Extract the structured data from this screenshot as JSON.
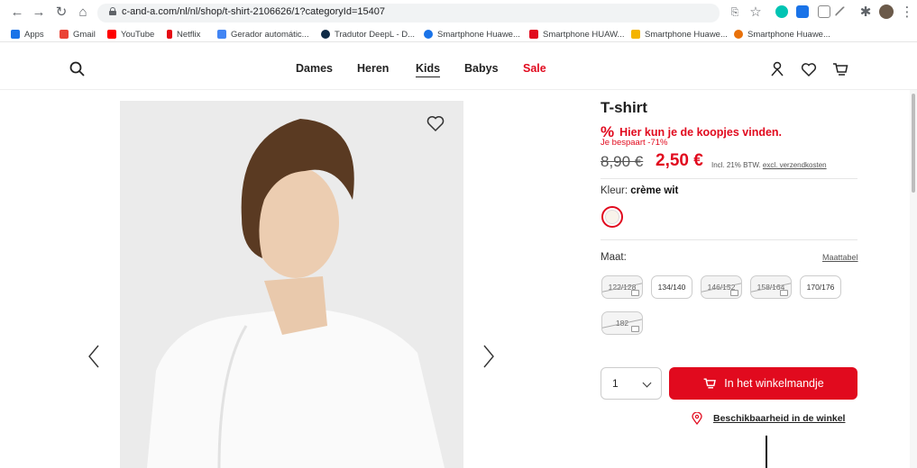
{
  "browser": {
    "url": "c-and-a.com/nl/nl/shop/t-shirt-2106626/1?categoryId=15407",
    "bookmarks": [
      {
        "label": "Apps",
        "color": "#1a73e8"
      },
      {
        "label": "Gmail",
        "color": "#ea4335"
      },
      {
        "label": "YouTube",
        "color": "#ff0000"
      },
      {
        "label": "Netflix",
        "color": "#e50914"
      },
      {
        "label": "Gerador automátic...",
        "color": "#4285f4"
      },
      {
        "label": "Tradutor DeepL - D...",
        "color": "#0f2b46"
      },
      {
        "label": "Smartphone Huawe...",
        "color": "#1a73e8"
      },
      {
        "label": "Smartphone HUAW...",
        "color": "#e10a1e"
      },
      {
        "label": "Smartphone Huawe...",
        "color": "#f4b400"
      },
      {
        "label": "Smartphone Huawe...",
        "color": "#e8710a"
      }
    ]
  },
  "header": {
    "menu": [
      "Dames",
      "Heren",
      "Kids",
      "Babys",
      "Sale"
    ],
    "active_menu": "Kids",
    "sale_color": "#e10a1e"
  },
  "product": {
    "title": "T-shirt",
    "promo_symbol": "%",
    "promo": "Hier kun je de koopjes vinden.",
    "saving": "Je bespaart -71%",
    "old_price": "8,90 €",
    "new_price": "2,50 €",
    "tax_note": "Incl. 21% BTW.",
    "shipping_note": "excl. verzendkosten",
    "color_label": "Kleur:",
    "color_value": "crème wit",
    "size_label": "Maat:",
    "size_table": "Maattabel",
    "sizes": [
      {
        "label": "122/128",
        "available": false
      },
      {
        "label": "134/140",
        "available": true
      },
      {
        "label": "146/152",
        "available": false
      },
      {
        "label": "158/164",
        "available": false
      },
      {
        "label": "170/176",
        "available": true
      },
      {
        "label": "182",
        "available": false
      }
    ],
    "quantity": "1",
    "cart_button": "In het winkelmandje",
    "store_availability": "Beschikbaarheid in de winkel",
    "accent_color": "#e10a1e"
  }
}
